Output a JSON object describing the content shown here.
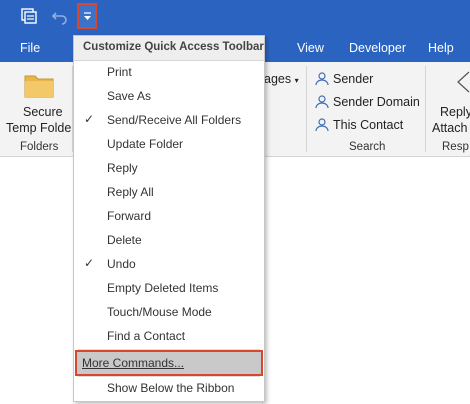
{
  "tabs": [
    "File",
    "View",
    "Developer",
    "Help"
  ],
  "ribbon": {
    "secure_line1": "Secure",
    "secure_line2": "Temp Folder",
    "folders_label": "Folders",
    "ages_partial": "ages",
    "sender": "Sender",
    "sender_domain": "Sender Domain",
    "this_contact": "This Contact",
    "search_label": "Search",
    "reply_partial": "Reply",
    "attach_partial": "Attach",
    "resp_partial": "Resp"
  },
  "menu": {
    "header": "Customize Quick Access Toolbar",
    "items": [
      {
        "label": "Print",
        "checked": false
      },
      {
        "label": "Save As",
        "checked": false
      },
      {
        "label": "Send/Receive All Folders",
        "checked": true
      },
      {
        "label": "Update Folder",
        "checked": false
      },
      {
        "label": "Reply",
        "checked": false
      },
      {
        "label": "Reply All",
        "checked": false
      },
      {
        "label": "Forward",
        "checked": false
      },
      {
        "label": "Delete",
        "checked": false
      },
      {
        "label": "Undo",
        "checked": true
      },
      {
        "label": "Empty Deleted Items",
        "checked": false
      },
      {
        "label": "Touch/Mouse Mode",
        "checked": false
      },
      {
        "label": "Find a Contact",
        "checked": false
      }
    ],
    "more_commands": "More Commands...",
    "show_below": "Show Below the Ribbon",
    "check_glyph": "✓"
  },
  "colors": {
    "title_bar": "#2b64c0",
    "highlight_border": "#d8472b"
  }
}
